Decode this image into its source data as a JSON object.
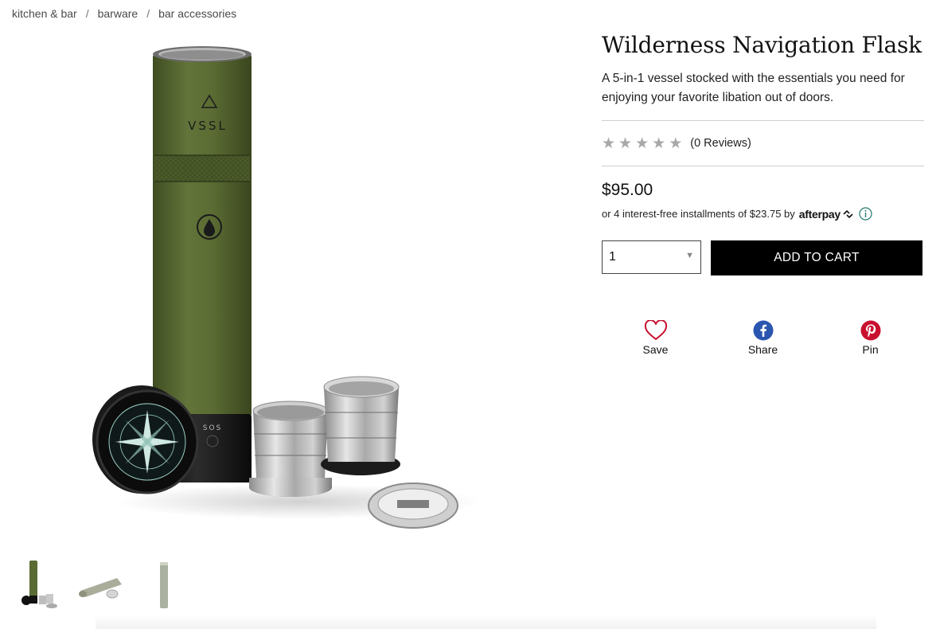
{
  "breadcrumb": {
    "items": [
      "kitchen & bar",
      "barware",
      "bar accessories"
    ],
    "separator": "/"
  },
  "product": {
    "title": "Wilderness Navigation Flask",
    "description": "A 5-in-1 vessel stocked with the essentials you need for enjoying your favorite libation out of doors.",
    "rating": {
      "stars": 5,
      "filled": 0,
      "reviews_label": "(0 Reviews)"
    },
    "price": "$95.00",
    "afterpay": {
      "text": "or 4 interest-free installments of $23.75 by",
      "brand": "afterpay",
      "info_icon": "info-circle-icon"
    },
    "quantity": {
      "selected": "1"
    },
    "add_to_cart_label": "ADD TO CART"
  },
  "flask_text": {
    "brand": "VSSL",
    "sos": "SOS"
  },
  "social": {
    "save": {
      "label": "Save",
      "icon": "heart-icon"
    },
    "share": {
      "label": "Share",
      "icon": "facebook-icon"
    },
    "pin": {
      "label": "Pin",
      "icon": "pinterest-icon"
    }
  },
  "thumbnails": {
    "count": 3,
    "selected_index": 0
  },
  "colors": {
    "flask_green": "#5a6b34",
    "button_black": "#000000",
    "heart_red": "#c8102e",
    "facebook_blue": "#2a56b0",
    "pinterest_red": "#c8102e",
    "star_gray": "#a8a8a8",
    "afterpay_info_teal": "#1f7a6f"
  }
}
